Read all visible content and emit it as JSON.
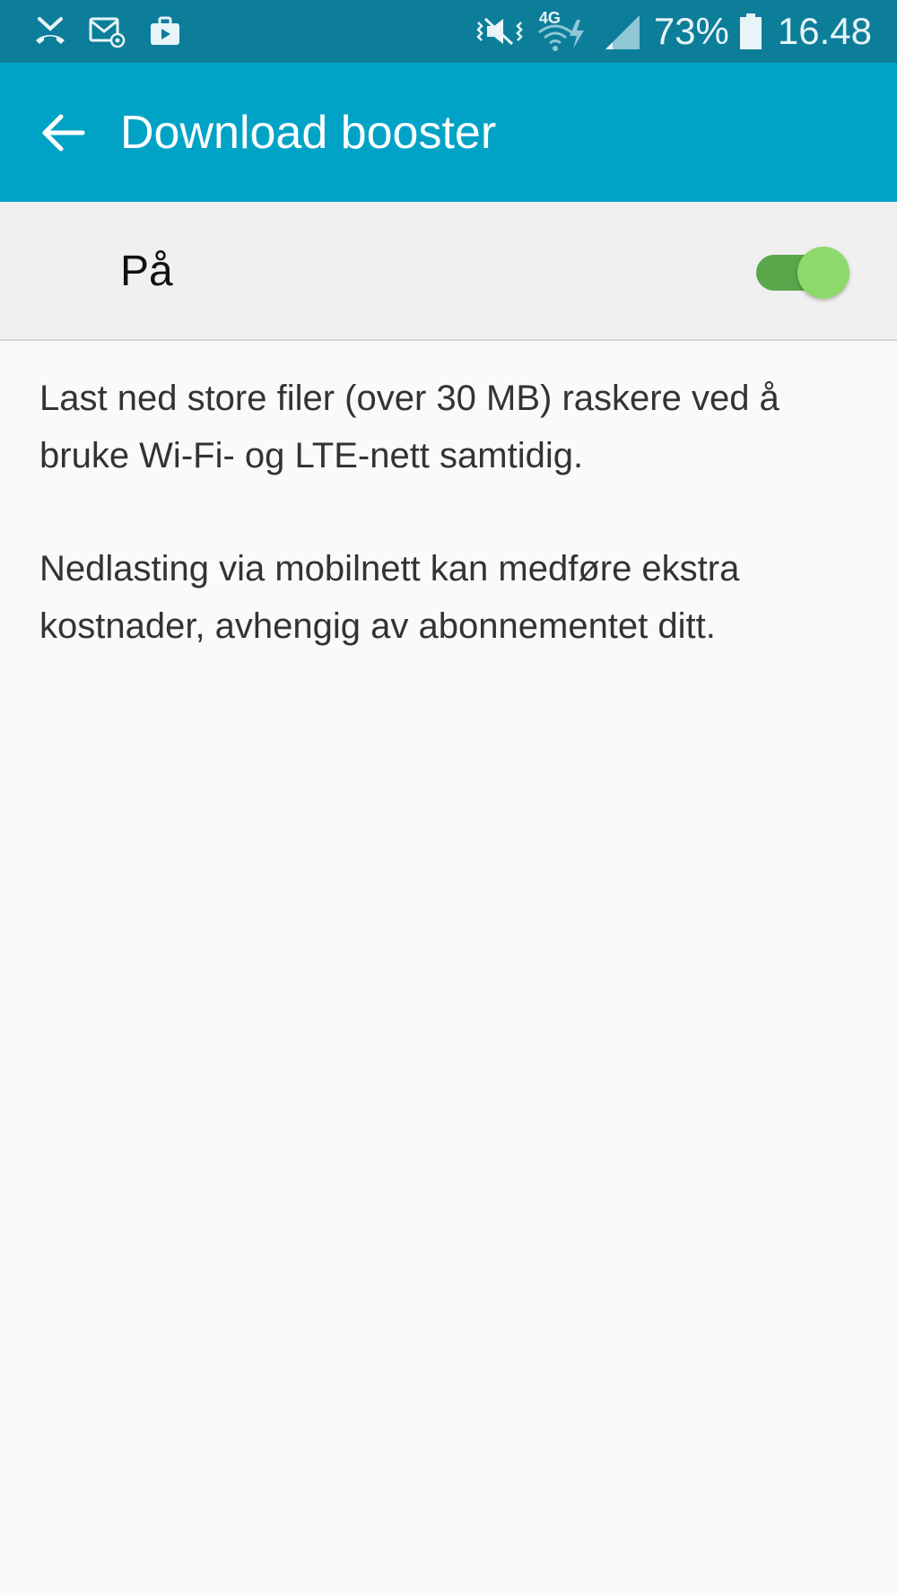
{
  "status_bar": {
    "battery_percent": "73%",
    "time": "16.48",
    "network_type": "4G",
    "icons": [
      "missed-call-icon",
      "email-icon",
      "briefcase-icon",
      "vibrate-icon",
      "wifi-icon",
      "signal-icon",
      "battery-icon"
    ]
  },
  "app_bar": {
    "title": "Download booster",
    "back_icon": "arrow-left-icon",
    "background_color": "#00a3c6"
  },
  "toggle": {
    "label": "På",
    "state": "on",
    "accent_color": "#5aa64b"
  },
  "description": {
    "paragraph_1": "Last ned store filer (over 30 MB) raskere ved å bruke Wi-Fi- og LTE-nett samtidig.",
    "paragraph_2": "Nedlasting via mobilnett kan medføre ekstra kostnader, avhengig av abonnementet ditt."
  }
}
